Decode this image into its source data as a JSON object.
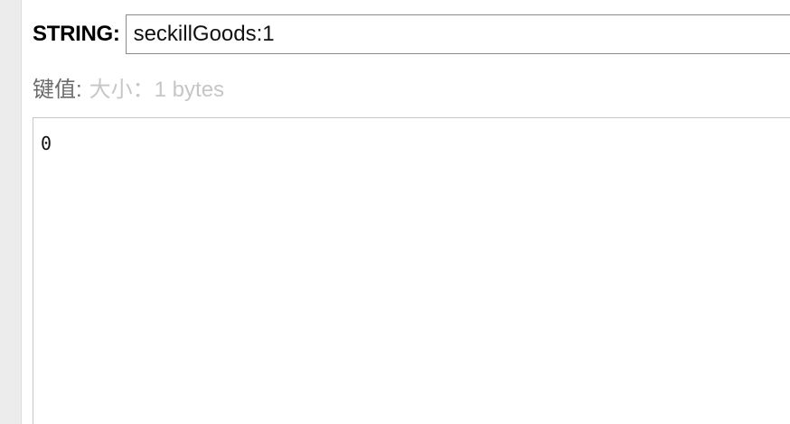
{
  "key": {
    "type_label": "STRING:",
    "name": "seckillGoods:1"
  },
  "value": {
    "label": "键值:",
    "size_text": "大小：1 bytes",
    "content": "0"
  }
}
